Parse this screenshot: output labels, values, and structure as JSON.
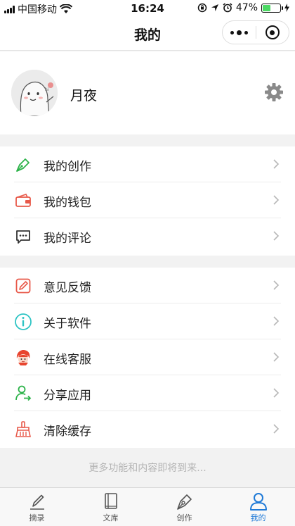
{
  "status_bar": {
    "carrier": "中国移动",
    "time": "16:24",
    "battery_percent": "47%",
    "battery_level": 0.47
  },
  "nav": {
    "title": "我的"
  },
  "profile": {
    "username": "月夜"
  },
  "menu_group_1": [
    {
      "label": "我的创作",
      "icon": "pen-nib-icon",
      "color": "#2db34a"
    },
    {
      "label": "我的钱包",
      "icon": "wallet-icon",
      "color": "#e8594a"
    },
    {
      "label": "我的评论",
      "icon": "comment-icon",
      "color": "#333333"
    }
  ],
  "menu_group_2": [
    {
      "label": "意见反馈",
      "icon": "feedback-edit-icon",
      "color": "#e8594a"
    },
    {
      "label": "关于软件",
      "icon": "info-icon",
      "color": "#2ec4c4"
    },
    {
      "label": "在线客服",
      "icon": "customer-service-icon",
      "color": "#e8452f"
    },
    {
      "label": "分享应用",
      "icon": "share-user-icon",
      "color": "#2db34a"
    },
    {
      "label": "清除缓存",
      "icon": "broom-icon",
      "color": "#e8594a"
    }
  ],
  "footer_note": "更多功能和内容即将到来...",
  "tabs": [
    {
      "label": "摘录",
      "icon": "pen-icon",
      "active": false
    },
    {
      "label": "文库",
      "icon": "book-icon",
      "active": false
    },
    {
      "label": "创作",
      "icon": "pen-nib-icon",
      "active": false
    },
    {
      "label": "我的",
      "icon": "user-icon",
      "active": true
    }
  ],
  "colors": {
    "accent": "#1f7ad7",
    "green": "#2db34a",
    "red": "#e8594a"
  }
}
